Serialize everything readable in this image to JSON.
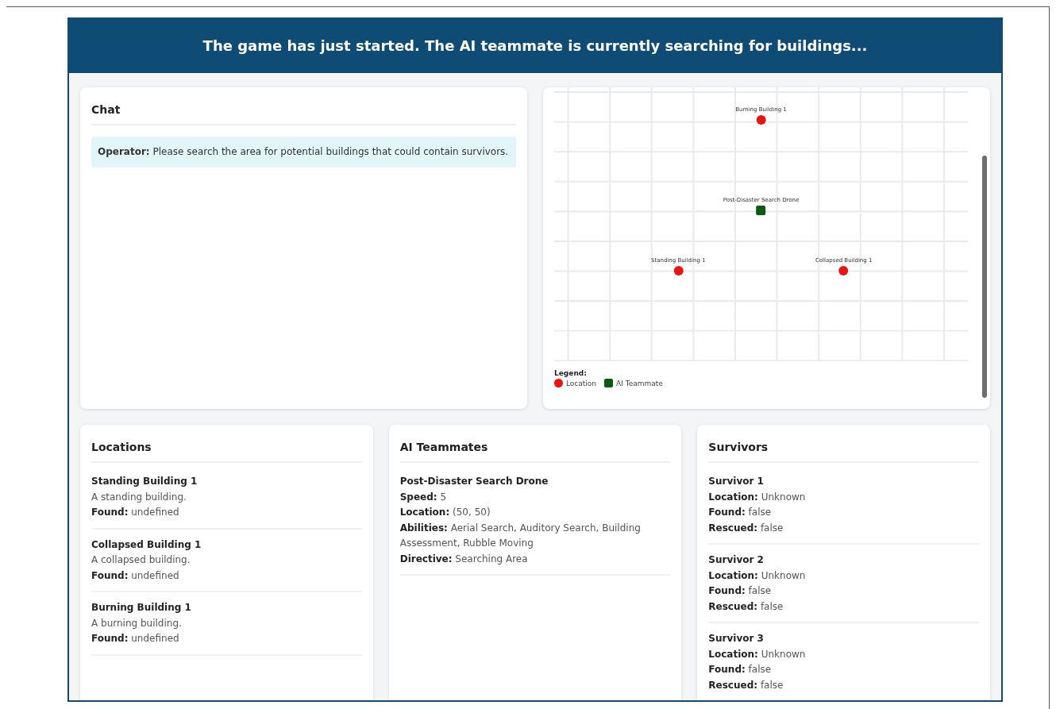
{
  "header": {
    "message": "The game has just started. The AI teammate is currently searching for buildings..."
  },
  "chat": {
    "title": "Chat",
    "messages": [
      {
        "sender": "Operator:",
        "text": "Please search the area for potential buildings that could contain survivors."
      }
    ]
  },
  "map": {
    "markers": [
      {
        "kind": "location",
        "label": "Burning Building 1"
      },
      {
        "kind": "teammate",
        "label": "Post-Disaster Search Drone"
      },
      {
        "kind": "location",
        "label": "Standing Building 1"
      },
      {
        "kind": "location",
        "label": "Collapsed Building 1"
      }
    ],
    "legend": {
      "title": "Legend:",
      "items": [
        {
          "kind": "location",
          "label": "Location"
        },
        {
          "kind": "teammate",
          "label": "AI Teammate"
        }
      ]
    }
  },
  "locations": {
    "title": "Locations",
    "items": [
      {
        "name": "Standing Building 1",
        "description": "A standing building.",
        "fields": [
          {
            "label": "Found:",
            "value": "undefined"
          }
        ]
      },
      {
        "name": "Collapsed Building 1",
        "description": "A collapsed building.",
        "fields": [
          {
            "label": "Found:",
            "value": "undefined"
          }
        ]
      },
      {
        "name": "Burning Building 1",
        "description": "A burning building.",
        "fields": [
          {
            "label": "Found:",
            "value": "undefined"
          }
        ]
      }
    ]
  },
  "teammates": {
    "title": "AI Teammates",
    "items": [
      {
        "name": "Post-Disaster Search Drone",
        "fields": [
          {
            "label": "Speed:",
            "value": "5"
          },
          {
            "label": "Location:",
            "value": "(50, 50)"
          },
          {
            "label": "Abilities:",
            "value": "Aerial Search, Auditory Search, Building Assessment, Rubble Moving"
          },
          {
            "label": "Directive:",
            "value": "Searching Area"
          }
        ]
      }
    ]
  },
  "survivors": {
    "title": "Survivors",
    "items": [
      {
        "name": "Survivor 1",
        "fields": [
          {
            "label": "Location:",
            "value": "Unknown"
          },
          {
            "label": "Found:",
            "value": "false"
          },
          {
            "label": "Rescued:",
            "value": "false"
          }
        ]
      },
      {
        "name": "Survivor 2",
        "fields": [
          {
            "label": "Location:",
            "value": "Unknown"
          },
          {
            "label": "Found:",
            "value": "false"
          },
          {
            "label": "Rescued:",
            "value": "false"
          }
        ]
      },
      {
        "name": "Survivor 3",
        "fields": [
          {
            "label": "Location:",
            "value": "Unknown"
          },
          {
            "label": "Found:",
            "value": "false"
          },
          {
            "label": "Rescued:",
            "value": "false"
          }
        ]
      }
    ]
  }
}
